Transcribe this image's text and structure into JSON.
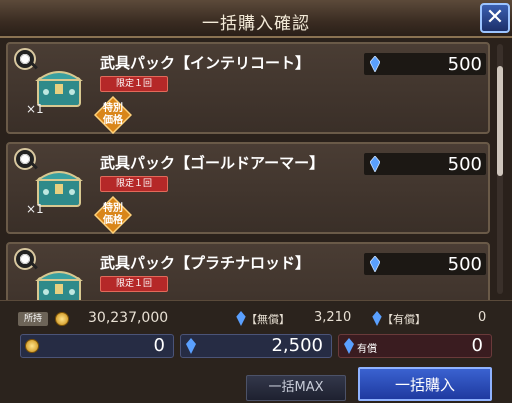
{
  "dialog": {
    "title": "一括購入確認",
    "close_label": "✕"
  },
  "items": [
    {
      "name": "武具パック【インテリコート】",
      "limited": "限定１回",
      "special_line1": "特別",
      "special_line2": "価格",
      "qty": "×1",
      "price": "500"
    },
    {
      "name": "武具パック【ゴールドアーマー】",
      "limited": "限定１回",
      "special_line1": "特別",
      "special_line2": "価格",
      "qty": "×1",
      "price": "500"
    },
    {
      "name": "武具パック【プラチナロッド】",
      "limited": "限定１回",
      "special_line1": "特別",
      "special_line2": "価格",
      "qty": "×1",
      "price": "500"
    }
  ],
  "wallet": {
    "owned_label": "所持",
    "gold": "30,237,000",
    "free_label": "【無償】",
    "free_value": "3,210",
    "paid_label": "【有償】",
    "paid_value": "0"
  },
  "totals": {
    "gold": "0",
    "gem": "2,500",
    "paid_tag": "有償",
    "paid": "0"
  },
  "buttons": {
    "bulk_max": "一括MAX",
    "bulk_buy": "一括購入"
  },
  "colors": {
    "accent_blue": "#2a4fb8",
    "limited_red": "#b52828",
    "special_orange": "#d9861a"
  }
}
